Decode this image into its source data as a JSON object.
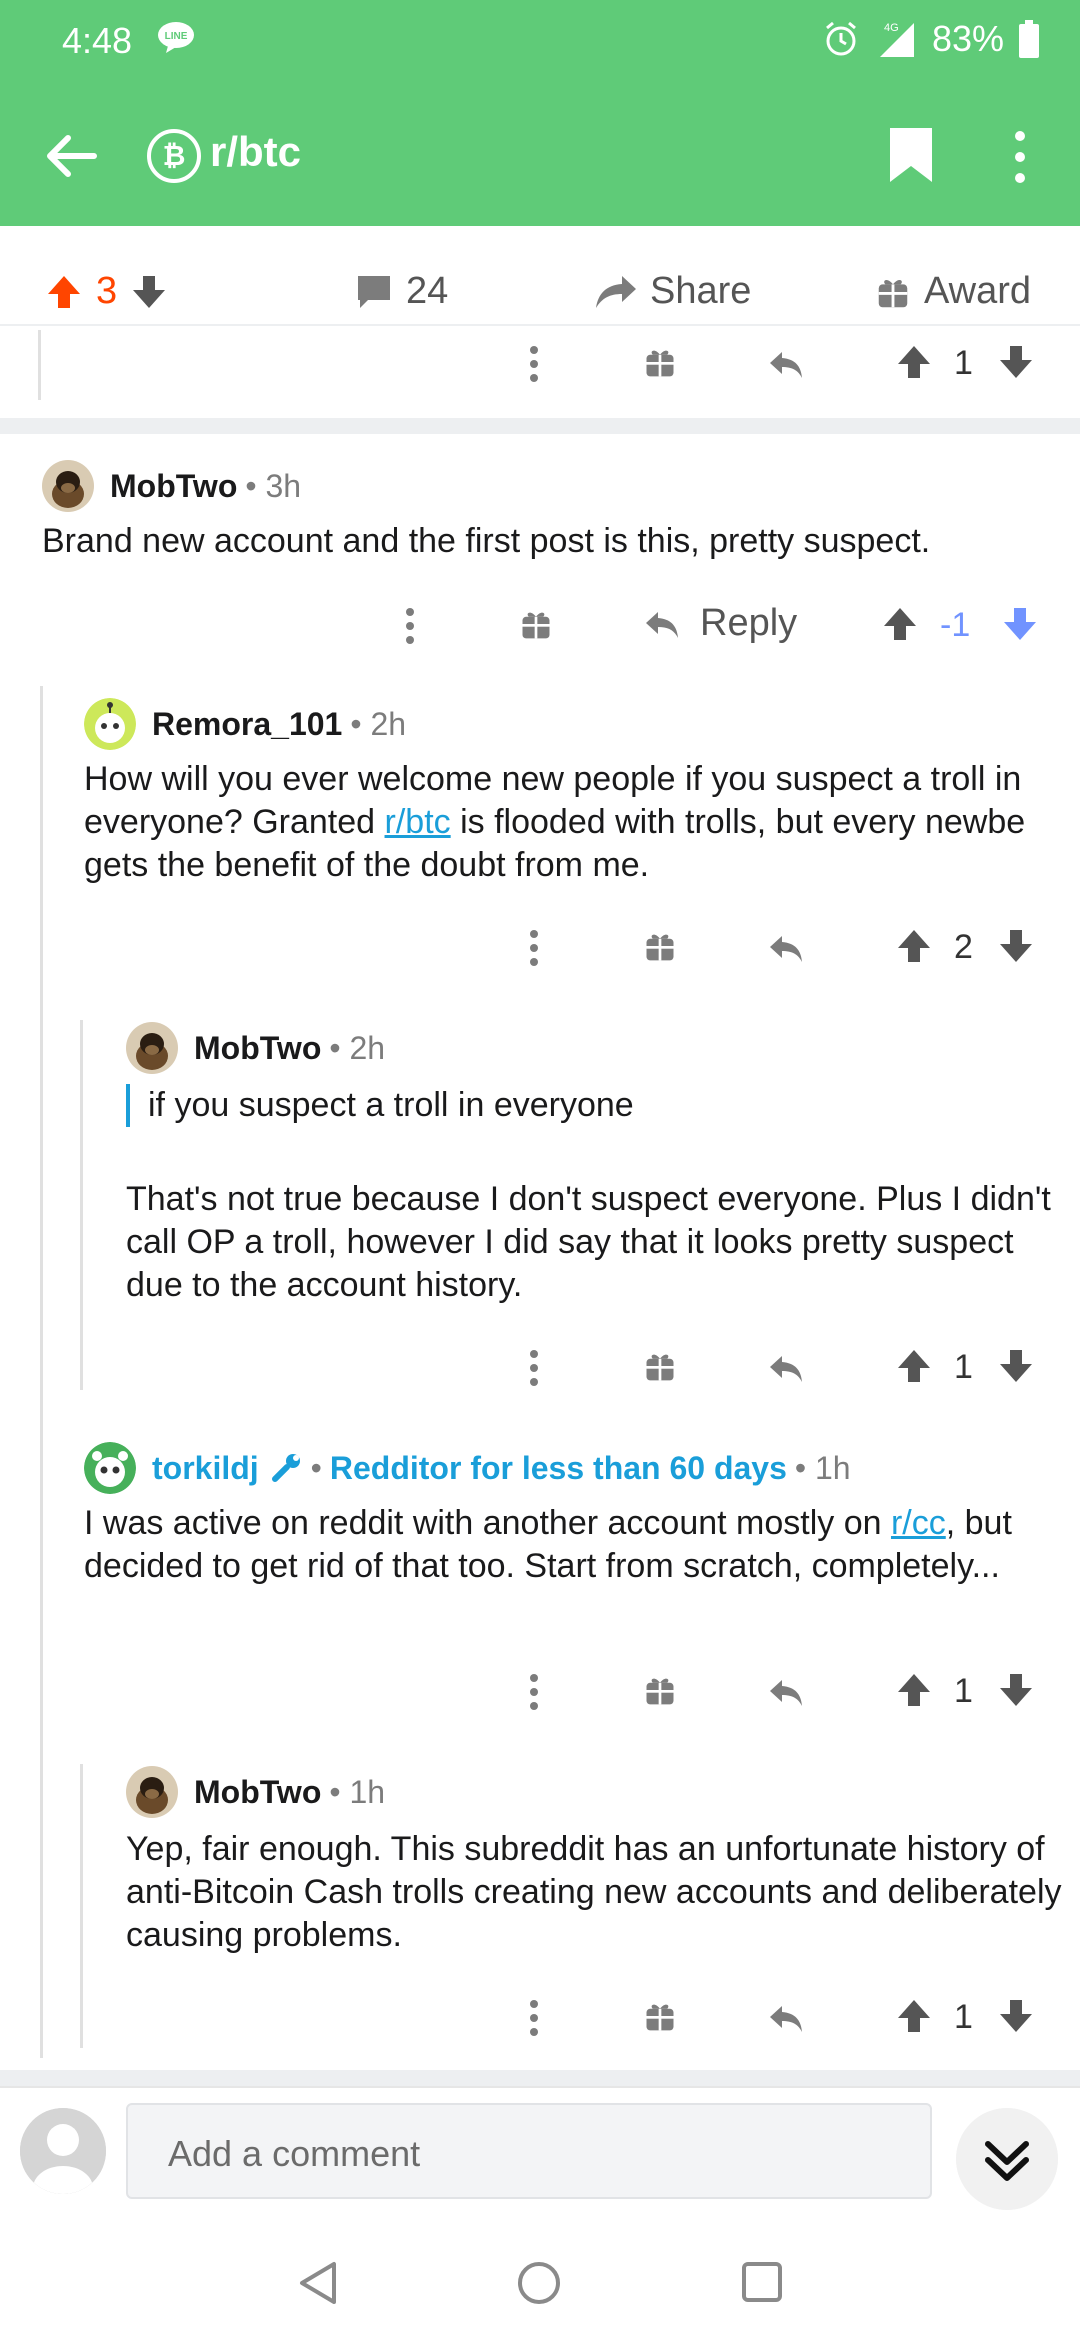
{
  "status": {
    "time": "4:48",
    "signal_label": "4G",
    "battery": "83%"
  },
  "appbar": {
    "title": "r/btc"
  },
  "postbar": {
    "score": "3",
    "comments": "24",
    "share": "Share",
    "award": "Award"
  },
  "top_comment_score": "1",
  "comments": [
    {
      "author": "MobTwo",
      "time": "3h",
      "text": "Brand new account and the first post is this, pretty suspect.",
      "reply_label": "Reply",
      "score": "-1"
    },
    {
      "author": "Remora_101",
      "time": "2h",
      "text_before_link": "How will you ever welcome new people if you suspect a troll in everyone? Granted ",
      "link": "r/btc",
      "text_after_link": " is flooded with trolls, but every newbe gets the benefit of the doubt from me.",
      "score": "2"
    },
    {
      "author": "MobTwo",
      "time": "2h",
      "quote": "if you suspect a troll in everyone",
      "text": "That's not true because I don't suspect everyone. Plus I didn't call OP a troll, however I did say that it looks pretty suspect due to the account history.",
      "score": "1"
    },
    {
      "author": "torkildj",
      "flair": "Redditor for less than 60 days",
      "time": "1h",
      "text_before_link": "I was active on reddit with another account mostly on ",
      "link": "r/cc",
      "text_after_link": ", but decided to get rid of that too. Start from scratch, completely...",
      "score": "1"
    },
    {
      "author": "MobTwo",
      "time": "1h",
      "text": "Yep, fair enough. This subreddit has an unfortunate history of anti-Bitcoin Cash trolls creating new accounts and deliberately causing problems.",
      "score": "1"
    }
  ],
  "composer": {
    "placeholder": "Add a comment"
  },
  "colors": {
    "accent": "#5fcb78",
    "upvote": "#ff4500",
    "downvote": "#7193ff",
    "link": "#1a9ed9"
  }
}
